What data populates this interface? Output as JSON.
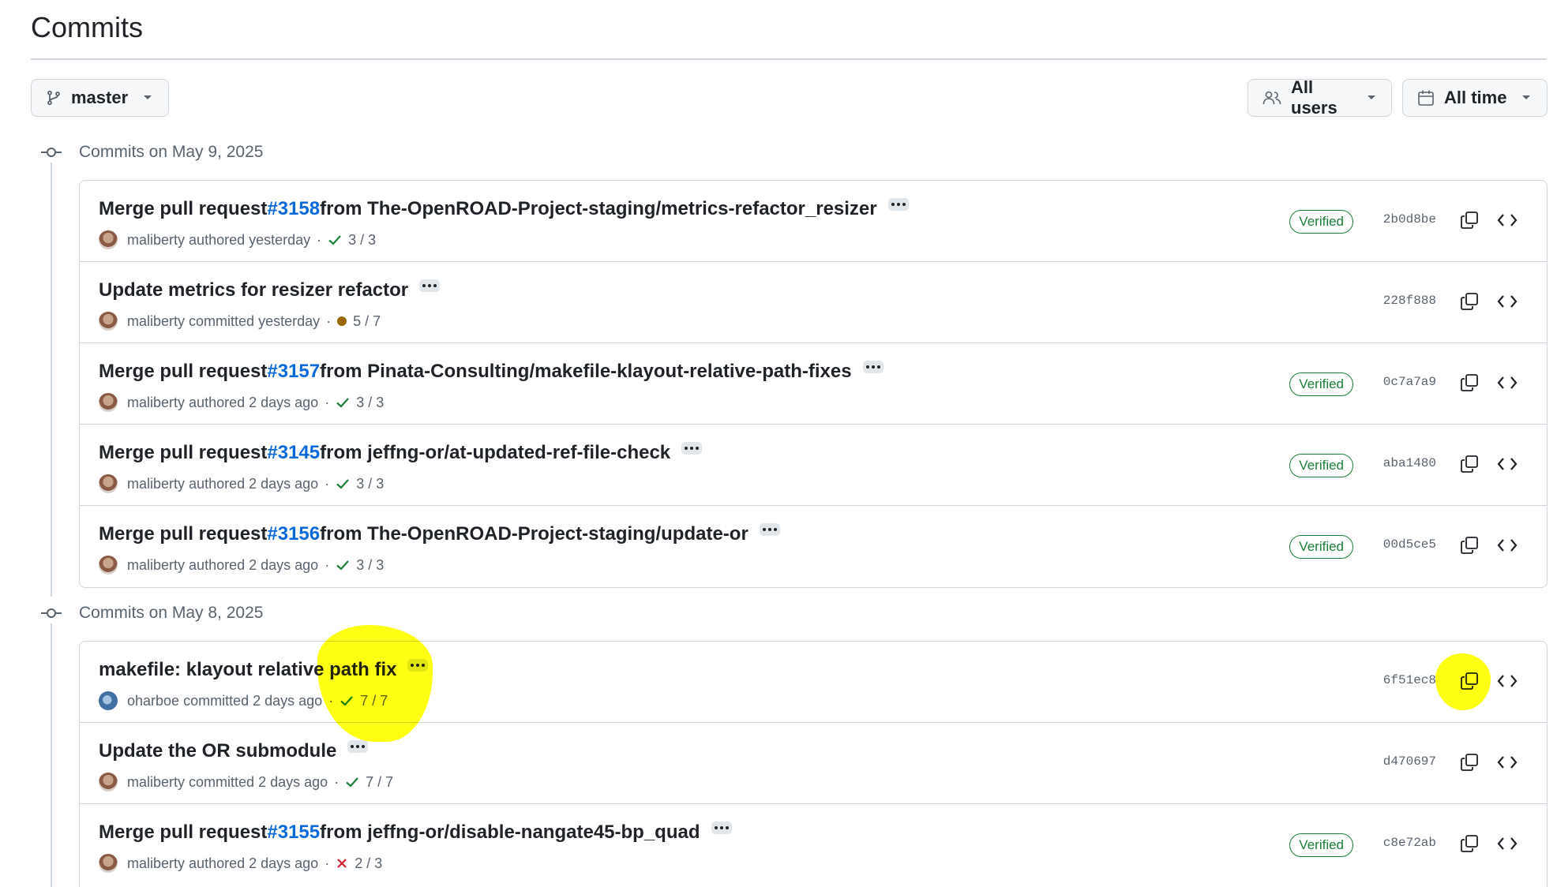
{
  "page": {
    "title": "Commits"
  },
  "filters": {
    "branch": "master",
    "users": "All users",
    "time": "All time"
  },
  "groups": [
    {
      "label": "Commits on May 9, 2025",
      "commits": [
        {
          "prefix": "Merge pull request ",
          "pr": "#3158",
          "suffix": " from The-OpenROAD-Project-staging/metrics-refactor_resizer",
          "author": "maliberty",
          "action": "authored",
          "when": "yesterday",
          "status": "success",
          "checks": "3 / 3",
          "verified": "Verified",
          "sha": "2b0d8be"
        },
        {
          "prefix": "Update metrics for resizer refactor",
          "pr": "",
          "suffix": "",
          "author": "maliberty",
          "action": "committed",
          "when": "yesterday",
          "status": "pending",
          "checks": "5 / 7",
          "verified": "",
          "sha": "228f888"
        },
        {
          "prefix": "Merge pull request ",
          "pr": "#3157",
          "suffix": " from Pinata-Consulting/makefile-klayout-relative-path-fixes",
          "author": "maliberty",
          "action": "authored",
          "when": "2 days ago",
          "status": "success",
          "checks": "3 / 3",
          "verified": "Verified",
          "sha": "0c7a7a9"
        },
        {
          "prefix": "Merge pull request ",
          "pr": "#3145",
          "suffix": " from jeffng-or/at-updated-ref-file-check",
          "author": "maliberty",
          "action": "authored",
          "when": "2 days ago",
          "status": "success",
          "checks": "3 / 3",
          "verified": "Verified",
          "sha": "aba1480"
        },
        {
          "prefix": "Merge pull request ",
          "pr": "#3156",
          "suffix": " from The-OpenROAD-Project-staging/update-or",
          "author": "maliberty",
          "action": "authored",
          "when": "2 days ago",
          "status": "success",
          "checks": "3 / 3",
          "verified": "Verified",
          "sha": "00d5ce5"
        }
      ]
    },
    {
      "label": "Commits on May 8, 2025",
      "commits": [
        {
          "prefix": "makefile: klayout relative path fix",
          "pr": "",
          "suffix": "",
          "author": "oharboe",
          "action": "committed",
          "when": "2 days ago",
          "status": "success",
          "checks": "7 / 7",
          "verified": "",
          "sha": "6f51ec8"
        },
        {
          "prefix": "Update the OR submodule",
          "pr": "",
          "suffix": "",
          "author": "maliberty",
          "action": "committed",
          "when": "2 days ago",
          "status": "success",
          "checks": "7 / 7",
          "verified": "",
          "sha": "d470697"
        },
        {
          "prefix": "Merge pull request ",
          "pr": "#3155",
          "suffix": " from jeffng-or/disable-nangate45-bp_quad",
          "author": "maliberty",
          "action": "authored",
          "when": "2 days ago",
          "status": "failure",
          "checks": "2 / 3",
          "verified": "Verified",
          "sha": "c8e72ab"
        }
      ]
    }
  ],
  "colors": {
    "link": "#0969da",
    "success": "#1a7f37",
    "pending": "#9a6700",
    "failure": "#cf222e",
    "highlight": "#ffff00"
  }
}
